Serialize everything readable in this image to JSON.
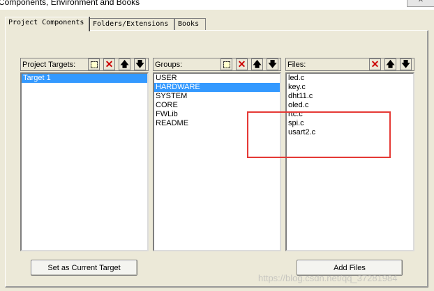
{
  "window": {
    "title": "Components, Environment and Books",
    "close_label": "✕"
  },
  "tabs": [
    {
      "label": "Project Components",
      "active": true
    },
    {
      "label": "Folders/Extensions",
      "active": false
    },
    {
      "label": "Books",
      "active": false
    }
  ],
  "targets": {
    "label": "Project Targets:",
    "items": [
      "Target 1"
    ],
    "selected": 0
  },
  "groups": {
    "label": "Groups:",
    "items": [
      "USER",
      "HARDWARE",
      "SYSTEM",
      "CORE",
      "FWLib",
      "README"
    ],
    "selected": 1
  },
  "files": {
    "label": "Files:",
    "items": [
      "led.c",
      "key.c",
      "dht11.c",
      "oled.c",
      "rtc.c",
      "spi.c",
      "usart2.c"
    ]
  },
  "buttons": {
    "set_current_target": "Set as Current Target",
    "add_files": "Add Files"
  },
  "icons": {
    "new": "new-item-icon",
    "delete": "delete-icon",
    "up": "move-up-icon",
    "down": "move-down-icon"
  },
  "watermark": "https://blog.csdn.net/qq_37281984",
  "colors": {
    "selection": "#3399ff",
    "highlight": "#e53935"
  }
}
